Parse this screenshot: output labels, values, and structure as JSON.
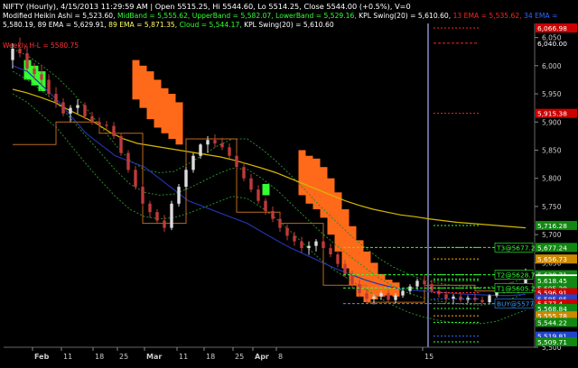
{
  "chart_data": {
    "type": "candlestick",
    "symbol": "NIFTY (Hourly)",
    "header": {
      "line1_prefix": "NIFTY (Hourly), 4/15/2013 11:29:59 AM | Open 5515.25, Hi 5544.60, Lo 5514.25, Close 5544.00 (+0.5%), V=0",
      "line2_parts": [
        {
          "text": "Modified Heikin Ashi = 5,523.60, ",
          "color": "#ffffff"
        },
        {
          "text": "MidBand = 5,555.62, ",
          "color": "#33ff33"
        },
        {
          "text": "UpperBand = 5,582.07, ",
          "color": "#33ff33"
        },
        {
          "text": "LowerBand = 5,529.16, ",
          "color": "#33ff33"
        },
        {
          "text": "KPL Swing(20) = 5,610.60, ",
          "color": "#ffffff"
        },
        {
          "text": "13 EMA = 5,535.62, ",
          "color": "#ff2222"
        },
        {
          "text": "34 EMA = ",
          "color": "#3366ff"
        }
      ],
      "line3_parts": [
        {
          "text": "5,580.19, ",
          "color": "#ffffff"
        },
        {
          "text": "89 EMA = 5,629.91, ",
          "color": "#ffffff"
        },
        {
          "text": "89 EMA = 5,871.35, ",
          "color": "#ffff66"
        },
        {
          "text": "Cloud = 5,544.17, ",
          "color": "#33ff33"
        },
        {
          "text": "KPL Swing(20) = 5,610.60",
          "color": "#ffffff"
        }
      ]
    },
    "inline_label": {
      "text": "Weekly H-L = 5580.75",
      "color": "#ff3333"
    },
    "y_axis": {
      "min": 5500,
      "max": 6075,
      "ticks": [
        "6,050",
        "6,000",
        "5,950",
        "5,900",
        "5,850",
        "5,800",
        "5,750",
        "5,700",
        "5,650",
        "5,600",
        "5,550",
        "5,500"
      ],
      "tick_values": [
        6050,
        6000,
        5950,
        5900,
        5850,
        5800,
        5750,
        5700,
        5650,
        5600,
        5550,
        5500
      ]
    },
    "x_axis": {
      "labels": [
        "Feb",
        "11",
        "18",
        "25",
        "Mar",
        "11",
        "18",
        "25",
        "Apr",
        "8",
        "15"
      ],
      "bold": [
        "Feb",
        "Mar",
        "Apr"
      ]
    },
    "candles": [
      [
        6010,
        6040,
        5995,
        6030
      ],
      [
        6030,
        6050,
        6015,
        6022
      ],
      [
        6022,
        6035,
        5990,
        5995
      ],
      [
        5995,
        6005,
        5975,
        5985
      ],
      [
        5985,
        6000,
        5965,
        5975
      ],
      [
        5975,
        5985,
        5945,
        5950
      ],
      [
        5950,
        5962,
        5925,
        5935
      ],
      [
        5935,
        5942,
        5910,
        5915
      ],
      [
        5915,
        5930,
        5900,
        5925
      ],
      [
        5925,
        5940,
        5915,
        5930
      ],
      [
        5930,
        5935,
        5905,
        5910
      ],
      [
        5910,
        5918,
        5895,
        5900
      ],
      [
        5900,
        5908,
        5885,
        5895
      ],
      [
        5895,
        5902,
        5885,
        5893
      ],
      [
        5893,
        5900,
        5870,
        5875
      ],
      [
        5875,
        5880,
        5840,
        5845
      ],
      [
        5845,
        5850,
        5810,
        5815
      ],
      [
        5815,
        5822,
        5780,
        5785
      ],
      [
        5785,
        5790,
        5750,
        5755
      ],
      [
        5755,
        5760,
        5730,
        5740
      ],
      [
        5740,
        5745,
        5720,
        5725
      ],
      [
        5725,
        5735,
        5705,
        5712
      ],
      [
        5712,
        5760,
        5708,
        5755
      ],
      [
        5755,
        5790,
        5750,
        5785
      ],
      [
        5785,
        5820,
        5780,
        5815
      ],
      [
        5815,
        5845,
        5810,
        5840
      ],
      [
        5840,
        5862,
        5835,
        5860
      ],
      [
        5860,
        5875,
        5845,
        5868
      ],
      [
        5868,
        5878,
        5855,
        5862
      ],
      [
        5862,
        5872,
        5850,
        5855
      ],
      [
        5855,
        5862,
        5835,
        5840
      ],
      [
        5840,
        5845,
        5815,
        5820
      ],
      [
        5820,
        5828,
        5795,
        5800
      ],
      [
        5800,
        5808,
        5775,
        5780
      ],
      [
        5780,
        5788,
        5755,
        5760
      ],
      [
        5760,
        5765,
        5735,
        5742
      ],
      [
        5742,
        5750,
        5722,
        5728
      ],
      [
        5728,
        5735,
        5705,
        5712
      ],
      [
        5712,
        5718,
        5690,
        5698
      ],
      [
        5698,
        5705,
        5680,
        5688
      ],
      [
        5688,
        5696,
        5668,
        5676
      ],
      [
        5676,
        5688,
        5664,
        5680
      ],
      [
        5680,
        5692,
        5670,
        5688
      ],
      [
        5688,
        5694,
        5672,
        5676
      ],
      [
        5676,
        5684,
        5660,
        5665
      ],
      [
        5665,
        5672,
        5642,
        5648
      ],
      [
        5648,
        5655,
        5625,
        5630
      ],
      [
        5630,
        5636,
        5605,
        5612
      ],
      [
        5612,
        5620,
        5590,
        5596
      ],
      [
        5596,
        5604,
        5580,
        5586
      ],
      [
        5586,
        5594,
        5576,
        5590
      ],
      [
        5590,
        5600,
        5584,
        5596
      ],
      [
        5596,
        5602,
        5580,
        5584
      ],
      [
        5584,
        5596,
        5578,
        5592
      ],
      [
        5592,
        5604,
        5588,
        5600
      ],
      [
        5600,
        5612,
        5594,
        5608
      ],
      [
        5608,
        5622,
        5602,
        5618
      ],
      [
        5618,
        5628,
        5606,
        5612
      ],
      [
        5612,
        5620,
        5596,
        5600
      ],
      [
        5600,
        5608,
        5588,
        5594
      ],
      [
        5594,
        5600,
        5580,
        5586
      ],
      [
        5586,
        5594,
        5576,
        5590
      ],
      [
        5590,
        5598,
        5580,
        5584
      ],
      [
        5584,
        5592,
        5578,
        5588
      ],
      [
        5588,
        5596,
        5580,
        5584
      ],
      [
        5584,
        5590,
        5576,
        5580
      ],
      [
        5580,
        5594,
        5576,
        5592
      ],
      [
        5592,
        5606,
        5588,
        5602
      ],
      [
        5602,
        5614,
        5596,
        5610
      ],
      [
        5610,
        5616,
        5596,
        5600
      ],
      [
        5600,
        5612,
        5596,
        5608
      ],
      [
        5608,
        5640,
        5604,
        5636
      ]
    ],
    "ema_yellow": [
      5958,
      5952,
      5944,
      5935,
      5922,
      5910,
      5898,
      5882,
      5870,
      5862,
      5858,
      5854,
      5850,
      5846,
      5842,
      5838,
      5832,
      5825,
      5818,
      5810,
      5800,
      5790,
      5780,
      5770,
      5760,
      5752,
      5745,
      5740,
      5735,
      5732,
      5728,
      5725,
      5722,
      5720,
      5718,
      5716,
      5714,
      5712
    ],
    "ema_blue": [
      6000,
      5990,
      5965,
      5940,
      5910,
      5880,
      5860,
      5840,
      5830,
      5820,
      5800,
      5780,
      5760,
      5750,
      5740,
      5730,
      5720,
      5705,
      5690,
      5676,
      5664,
      5652,
      5640,
      5630,
      5620,
      5612,
      5606,
      5602,
      5600,
      5598,
      5596,
      5594,
      5593,
      5592,
      5592,
      5594
    ],
    "bands": {
      "mid": [
        5990,
        5975,
        5955,
        5935,
        5905,
        5875,
        5845,
        5815,
        5790,
        5775,
        5770,
        5772,
        5782,
        5795,
        5808,
        5818,
        5816,
        5800,
        5780,
        5755,
        5730,
        5705,
        5683,
        5662,
        5642,
        5623,
        5608,
        5596,
        5588,
        5582,
        5578,
        5576,
        5575,
        5578,
        5586,
        5596
      ],
      "upper": [
        6030,
        6018,
        6000,
        5980,
        5955,
        5925,
        5892,
        5860,
        5832,
        5815,
        5810,
        5812,
        5826,
        5842,
        5858,
        5870,
        5870,
        5852,
        5830,
        5805,
        5778,
        5750,
        5725,
        5700,
        5678,
        5658,
        5642,
        5630,
        5620,
        5614,
        5610,
        5608,
        5606,
        5608,
        5614,
        5624
      ],
      "lower": [
        5950,
        5935,
        5912,
        5890,
        5858,
        5826,
        5796,
        5768,
        5745,
        5732,
        5728,
        5730,
        5738,
        5748,
        5758,
        5768,
        5764,
        5748,
        5728,
        5705,
        5680,
        5656,
        5636,
        5620,
        5604,
        5588,
        5574,
        5562,
        5554,
        5548,
        5544,
        5542,
        5542,
        5546,
        5556,
        5566
      ]
    },
    "kpl_swing_steps": [
      [
        0,
        5860
      ],
      [
        6,
        5860
      ],
      [
        6,
        5900
      ],
      [
        12,
        5900
      ],
      [
        12,
        5880
      ],
      [
        18,
        5880
      ],
      [
        18,
        5720
      ],
      [
        24,
        5720
      ],
      [
        24,
        5870
      ],
      [
        31,
        5870
      ],
      [
        31,
        5740
      ],
      [
        37,
        5740
      ],
      [
        37,
        5720
      ],
      [
        43,
        5720
      ],
      [
        43,
        5610
      ],
      [
        49,
        5610
      ],
      [
        49,
        5580
      ],
      [
        57,
        5580
      ],
      [
        57,
        5610
      ],
      [
        64,
        5610
      ],
      [
        64,
        5600
      ],
      [
        71,
        5600
      ]
    ],
    "cloud_orange": [
      [
        17,
        6010,
        5940
      ],
      [
        18,
        6000,
        5925
      ],
      [
        19,
        5990,
        5905
      ],
      [
        20,
        5975,
        5890
      ],
      [
        21,
        5960,
        5880
      ],
      [
        22,
        5950,
        5870
      ],
      [
        23,
        5935,
        5860
      ],
      [
        40,
        5850,
        5770
      ],
      [
        41,
        5840,
        5755
      ],
      [
        42,
        5835,
        5745
      ],
      [
        43,
        5820,
        5730
      ],
      [
        44,
        5800,
        5700
      ],
      [
        45,
        5775,
        5670
      ],
      [
        46,
        5745,
        5640
      ],
      [
        47,
        5715,
        5610
      ],
      [
        48,
        5690,
        5590
      ],
      [
        49,
        5670,
        5580
      ],
      [
        50,
        5650,
        5585
      ],
      [
        51,
        5630,
        5590
      ],
      [
        52,
        5620,
        5592
      ],
      [
        53,
        5615,
        5590
      ]
    ],
    "cloud_green": [
      [
        2,
        6010,
        5975
      ],
      [
        3,
        6000,
        5965
      ],
      [
        4,
        5990,
        5955
      ],
      [
        35,
        5790,
        5770
      ]
    ],
    "horizontal_levels": [
      {
        "price": 6066.98,
        "label": "6,066.98",
        "color": "#ff2222",
        "label_bg": "#cc0000"
      },
      {
        "price": 6040,
        "label": "6,040.00",
        "color": "#ff2222",
        "style": "dash",
        "label_bg": null
      },
      {
        "price": 5915.38,
        "label": "5,915.38",
        "color": "#ff2222",
        "label_bg": "#cc0000"
      },
      {
        "price": 5716.28,
        "label": "5,716.28",
        "color": "#33ff33",
        "label_bg": "#118811"
      },
      {
        "price": 5677.24,
        "label": "5,677.24",
        "color": "#33ff33",
        "label_bg": "#118811"
      },
      {
        "price": 5656.73,
        "label": "5,656.73",
        "color": "#ffaa00",
        "label_bg": "#cc8800"
      },
      {
        "price": 5628.71,
        "label": "5,628.71",
        "color": "#33ff33",
        "label_bg": "#118811"
      },
      {
        "price": 5621.37,
        "label": "5,621.37",
        "color": "#000000",
        "label_bg": "#ffffff"
      },
      {
        "price": 5618.45,
        "label": "5,618.45",
        "color": "#33ff33",
        "label_bg": "#118811"
      },
      {
        "price": 5605.29,
        "label": "5,605.29",
        "color": "#33ff33",
        "label_bg": "#118811"
      },
      {
        "price": 5596.91,
        "label": "5,596.91",
        "color": "#ff3333",
        "label_bg": "#cc0000"
      },
      {
        "price": 5585.85,
        "label": "5,585.85",
        "color": "#3366ff",
        "label_bg": "#2244cc"
      },
      {
        "price": 5577.4,
        "label": "5,577.4",
        "color": "#ff3333",
        "label_bg": "#cc0000"
      },
      {
        "price": 5568.84,
        "label": "5,568.84",
        "color": "#33ff33",
        "label_bg": "#118811"
      },
      {
        "price": 5555.78,
        "label": "5,555.78",
        "color": "#ffaa00",
        "label_bg": "#cc8800"
      },
      {
        "price": 5544.22,
        "label": "5,544.22",
        "color": "#33ff33",
        "label_bg": "#118811"
      },
      {
        "price": 5519.81,
        "label": "5,519.81",
        "color": "#3366ff",
        "label_bg": "#2244cc"
      },
      {
        "price": 5509.71,
        "label": "5,509.71",
        "color": "#33ff33",
        "label_bg": "#118811"
      }
    ],
    "target_labels": [
      {
        "text": "T3@5677.24",
        "price": 5677.24,
        "color": "#33ff33"
      },
      {
        "text": "T2@5628.71",
        "price": 5628.71,
        "color": "#33ff33"
      },
      {
        "text": "T1@5605.29",
        "price": 5605.29,
        "color": "#33ff33"
      },
      {
        "text": "BUY@5577.4",
        "price": 5577.4,
        "color": "#3399ff"
      }
    ],
    "colors": {
      "background": "#000000",
      "axis": "#888888",
      "candle_body": "#dddddd",
      "candle_down": "#c03a3a",
      "ema_yellow": "#d6b800",
      "ema_blue": "#2233aa",
      "bands": "#2a8a2a",
      "swing": "#b86a20",
      "cloud_orange": "#ff6a1a",
      "cloud_green": "#33ff33",
      "cursor_line": "#b0b0ff"
    }
  }
}
